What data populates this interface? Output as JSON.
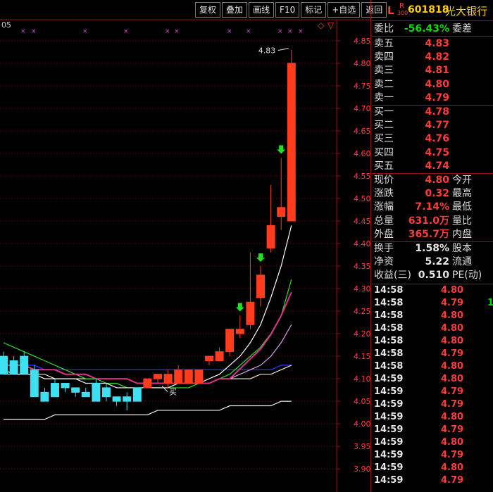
{
  "toolbar": {
    "buttons": [
      "复权",
      "叠加",
      "画线",
      "F10",
      "标记",
      "+自选",
      "返回"
    ]
  },
  "indicator_label": "05",
  "markers": {
    "up": "◇",
    "down": "▽"
  },
  "annotations": {
    "high_label": "4.83",
    "buy_label": "买"
  },
  "header": {
    "l_mark": "L",
    "r_mark": "R",
    "r_sub": "300",
    "code": "601818",
    "name": "光大银行"
  },
  "panel": {
    "weibi": {
      "label": "委比",
      "value": "-56.43%",
      "label2": "委差"
    },
    "asks": [
      {
        "label": "卖五",
        "price": "4.83"
      },
      {
        "label": "卖四",
        "price": "4.82"
      },
      {
        "label": "卖三",
        "price": "4.81"
      },
      {
        "label": "卖二",
        "price": "4.80"
      },
      {
        "label": "卖一",
        "price": "4.79"
      }
    ],
    "bids": [
      {
        "label": "买一",
        "price": "4.78"
      },
      {
        "label": "买二",
        "price": "4.77"
      },
      {
        "label": "买三",
        "price": "4.76"
      },
      {
        "label": "买四",
        "price": "4.75"
      },
      {
        "label": "买五",
        "price": "4.74"
      }
    ],
    "stats1": [
      {
        "label": "现价",
        "value": "4.80",
        "label2": "今开"
      },
      {
        "label": "涨跌",
        "value": "0.32",
        "label2": "最高"
      },
      {
        "label": "涨幅",
        "value": "7.14%",
        "label2": "最低"
      },
      {
        "label": "总量",
        "value": "631.0万",
        "label2": "量比"
      },
      {
        "label": "外盘",
        "value": "365.7万",
        "label2": "内盘"
      }
    ],
    "stats2": [
      {
        "label": "换手",
        "value": "1.58%",
        "label2": "股本"
      },
      {
        "label": "净资",
        "value": "5.22",
        "label2": "流通"
      },
      {
        "label": "收益(三)",
        "value": "0.510",
        "label2": "PE(动)"
      }
    ],
    "ticks": [
      {
        "time": "14:58",
        "price": "4.80",
        "x": "",
        "color": "red"
      },
      {
        "time": "14:58",
        "price": "4.79",
        "x": "1",
        "color": "green"
      },
      {
        "time": "14:58",
        "price": "4.80",
        "x": "",
        "color": "red"
      },
      {
        "time": "14:58",
        "price": "4.80",
        "x": "",
        "color": "red"
      },
      {
        "time": "14:58",
        "price": "4.80",
        "x": "",
        "color": "red"
      },
      {
        "time": "14:58",
        "price": "4.79",
        "x": "",
        "color": "green"
      },
      {
        "time": "14:58",
        "price": "4.80",
        "x": "",
        "color": "red"
      },
      {
        "time": "14:59",
        "price": "4.80",
        "x": "",
        "color": "red"
      },
      {
        "time": "14:59",
        "price": "4.79",
        "x": "",
        "color": "green"
      },
      {
        "time": "14:59",
        "price": "4.79",
        "x": "",
        "color": "green"
      },
      {
        "time": "14:59",
        "price": "4.80",
        "x": "",
        "color": "red"
      },
      {
        "time": "14:59",
        "price": "4.79",
        "x": "",
        "color": "green"
      },
      {
        "time": "14:59",
        "price": "4.80",
        "x": "",
        "color": "red"
      },
      {
        "time": "14:59",
        "price": "4.79",
        "x": "",
        "color": "green"
      },
      {
        "time": "14:59",
        "price": "4.80",
        "x": "",
        "color": "red"
      },
      {
        "time": "14:59",
        "price": "4.79",
        "x": "",
        "color": "green"
      }
    ]
  },
  "colors": {
    "up": "#ff3c1e",
    "down": "#3ce0f0",
    "axis_red": "#ff3c3c",
    "grid": "#8a0a0a"
  },
  "chart_data": {
    "type": "candlestick",
    "ylim": [
      3.88,
      4.87
    ],
    "y_ticks": [
      "4.85",
      "4.80",
      "4.75",
      "4.70",
      "4.65",
      "4.60",
      "4.55",
      "4.50",
      "4.45",
      "4.40",
      "4.35",
      "4.30",
      "4.25",
      "4.20",
      "4.15",
      "4.10",
      "4.05",
      "4.00",
      "3.95",
      "3.90"
    ],
    "candles": [
      {
        "o": 4.15,
        "h": 4.16,
        "l": 4.11,
        "c": 4.11
      },
      {
        "o": 4.14,
        "h": 4.15,
        "l": 4.11,
        "c": 4.11
      },
      {
        "o": 4.15,
        "h": 4.16,
        "l": 4.11,
        "c": 4.11
      },
      {
        "o": 4.12,
        "h": 4.13,
        "l": 4.06,
        "c": 4.06
      },
      {
        "o": 4.07,
        "h": 4.08,
        "l": 4.05,
        "c": 4.05
      },
      {
        "o": 4.09,
        "h": 4.1,
        "l": 4.06,
        "c": 4.06
      },
      {
        "o": 4.09,
        "h": 4.09,
        "l": 4.07,
        "c": 4.08
      },
      {
        "o": 4.08,
        "h": 4.08,
        "l": 4.06,
        "c": 4.07
      },
      {
        "o": 4.07,
        "h": 4.08,
        "l": 4.06,
        "c": 4.06
      },
      {
        "o": 4.09,
        "h": 4.1,
        "l": 4.05,
        "c": 4.05
      },
      {
        "o": 4.08,
        "h": 4.09,
        "l": 4.05,
        "c": 4.06
      },
      {
        "o": 4.06,
        "h": 4.06,
        "l": 4.04,
        "c": 4.05
      },
      {
        "o": 4.06,
        "h": 4.07,
        "l": 4.03,
        "c": 4.05
      },
      {
        "o": 4.08,
        "h": 4.08,
        "l": 4.05,
        "c": 4.05
      },
      {
        "o": 4.08,
        "h": 4.1,
        "l": 4.08,
        "c": 4.1
      },
      {
        "o": 4.1,
        "h": 4.11,
        "l": 4.09,
        "c": 4.11
      },
      {
        "o": 4.09,
        "h": 4.12,
        "l": 4.08,
        "c": 4.11
      },
      {
        "o": 4.09,
        "h": 4.13,
        "l": 4.09,
        "c": 4.12
      },
      {
        "o": 4.09,
        "h": 4.12,
        "l": 4.09,
        "c": 4.12
      },
      {
        "o": 4.09,
        "h": 4.12,
        "l": 4.09,
        "c": 4.12
      },
      {
        "o": 4.14,
        "h": 4.15,
        "l": 4.13,
        "c": 4.15
      },
      {
        "o": 4.14,
        "h": 4.17,
        "l": 4.14,
        "c": 4.16
      },
      {
        "o": 4.16,
        "h": 4.21,
        "l": 4.15,
        "c": 4.21
      },
      {
        "o": 4.2,
        "h": 4.24,
        "l": 4.19,
        "c": 4.21
      },
      {
        "o": 4.22,
        "h": 4.38,
        "l": 4.21,
        "c": 4.27
      },
      {
        "o": 4.28,
        "h": 4.35,
        "l": 4.26,
        "c": 4.33
      },
      {
        "o": 4.39,
        "h": 4.53,
        "l": 4.38,
        "c": 4.44
      },
      {
        "o": 4.46,
        "h": 4.59,
        "l": 4.43,
        "c": 4.48
      },
      {
        "o": 4.45,
        "h": 4.83,
        "l": 4.45,
        "c": 4.8
      }
    ],
    "ma_white": [
      4.12,
      4.11,
      4.11,
      4.11,
      4.1,
      4.1,
      4.1,
      4.1,
      4.09,
      4.09,
      4.09,
      4.08,
      4.08,
      4.08,
      4.08,
      4.08,
      4.08,
      4.09,
      4.09,
      4.09,
      4.1,
      4.11,
      4.13,
      4.15,
      4.18,
      4.22,
      4.28,
      4.35,
      4.44
    ],
    "ma_green": [
      4.18,
      4.17,
      4.16,
      4.15,
      4.14,
      4.13,
      4.12,
      4.11,
      4.1,
      4.1,
      4.09,
      4.09,
      4.08,
      4.08,
      4.08,
      4.08,
      4.08,
      4.08,
      4.08,
      4.09,
      4.09,
      4.1,
      4.11,
      4.13,
      4.15,
      4.17,
      4.2,
      4.24,
      4.32
    ],
    "ma_purple": [
      4.13,
      4.13,
      4.13,
      4.12,
      4.12,
      4.12,
      4.11,
      4.11,
      4.11,
      4.1,
      4.1,
      4.1,
      4.1,
      4.09,
      4.09,
      4.09,
      4.09,
      4.09,
      4.09,
      4.09,
      4.09,
      4.1,
      4.1,
      4.11,
      4.12,
      4.13,
      4.15,
      4.18,
      4.22
    ],
    "ma_blue": [
      4.13,
      4.13,
      4.13,
      4.13,
      4.12,
      4.12,
      4.12,
      4.12,
      4.12,
      4.12,
      4.12,
      4.12,
      4.12,
      4.12,
      4.12,
      4.12,
      4.12,
      4.12,
      4.12,
      4.12,
      4.12,
      4.12,
      4.12,
      4.12,
      4.12,
      4.12,
      4.12,
      4.13,
      4.13
    ],
    "ma_cream": [
      4.11,
      4.11,
      4.11,
      4.11,
      4.11,
      4.1,
      4.1,
      4.1,
      4.1,
      4.1,
      4.1,
      4.1,
      4.1,
      4.09,
      4.09,
      4.09,
      4.09,
      4.09,
      4.09,
      4.09,
      4.09,
      4.1,
      4.1,
      4.1,
      4.1,
      4.11,
      4.11,
      4.12,
      4.13
    ],
    "ma_long": [
      4.01,
      4.01,
      4.01,
      4.01,
      4.01,
      4.02,
      4.02,
      4.02,
      4.02,
      4.02,
      4.02,
      4.02,
      4.02,
      4.02,
      4.02,
      4.03,
      4.03,
      4.03,
      4.03,
      4.03,
      4.03,
      4.03,
      4.04,
      4.04,
      4.04,
      4.04,
      4.04,
      4.05,
      4.05
    ],
    "down_arrows_at_index": [
      23,
      25,
      27
    ],
    "buy_at_index": 15
  }
}
